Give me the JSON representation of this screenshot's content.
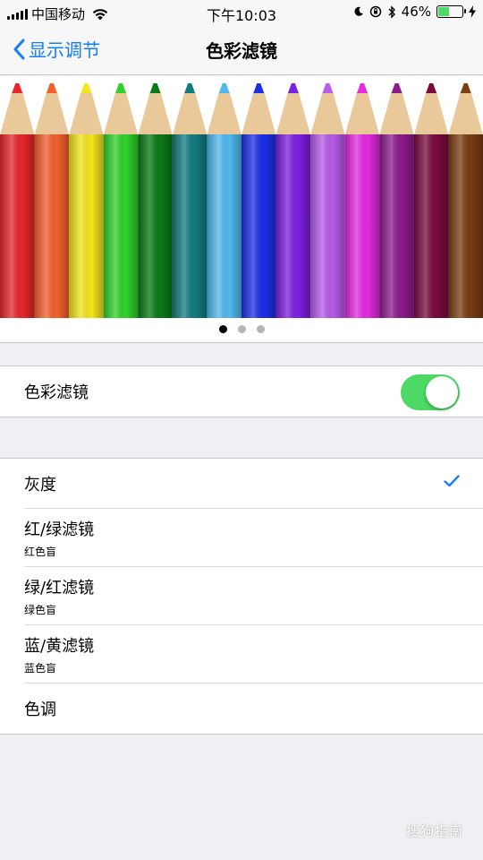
{
  "status_bar": {
    "carrier": "中国移动",
    "time": "下午10:03",
    "battery_percent": "46%",
    "battery_level": 0.46,
    "icons": [
      "signal-icon",
      "wifi-icon",
      "moon-icon",
      "rotation-lock-icon",
      "bluetooth-icon",
      "battery-icon",
      "charging-icon"
    ]
  },
  "nav": {
    "back_label": "显示调节",
    "title": "色彩滤镜"
  },
  "preview": {
    "pencil_colors": [
      "#e8262b",
      "#f2602c",
      "#f5e51b",
      "#2fd22a",
      "#0a7a17",
      "#127c80",
      "#4fb9ee",
      "#1c2ee6",
      "#7d1fe0",
      "#b75ae8",
      "#e52ae0",
      "#8b1a8a",
      "#7a0a3e",
      "#7a3c12"
    ],
    "page_count": 3,
    "active_page": 0
  },
  "filter_toggle": {
    "label": "色彩滤镜",
    "on": true
  },
  "filters": [
    {
      "label": "灰度",
      "sub": "",
      "selected": true
    },
    {
      "label": "红/绿滤镜",
      "sub": "红色盲",
      "selected": false
    },
    {
      "label": "绿/红滤镜",
      "sub": "绿色盲",
      "selected": false
    },
    {
      "label": "蓝/黄滤镜",
      "sub": "蓝色盲",
      "selected": false
    },
    {
      "label": "色调",
      "sub": "",
      "selected": false
    }
  ],
  "colors": {
    "accent": "#147efb",
    "toggle_on": "#4cd964",
    "background": "#efeff4"
  },
  "watermark": "搜狗指南"
}
